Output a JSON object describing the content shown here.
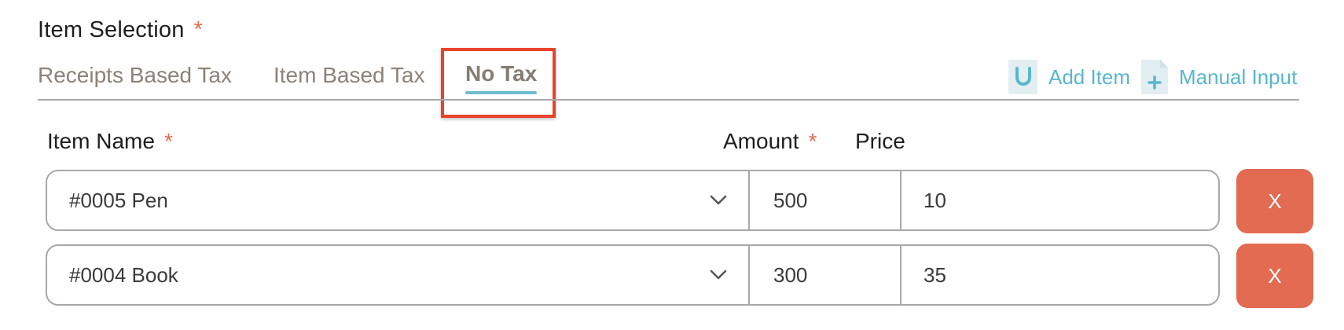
{
  "section": {
    "title": "Item Selection",
    "required_mark": "*"
  },
  "tabs": [
    {
      "label": "Receipts Based Tax",
      "active": false
    },
    {
      "label": "Item Based Tax",
      "active": false
    },
    {
      "label": "No Tax",
      "active": true
    }
  ],
  "actions": {
    "add_item": {
      "label": "Add Item",
      "icon": "add-item-icon"
    },
    "manual_input": {
      "label": "Manual Input",
      "icon": "document-plus-icon"
    }
  },
  "columns": {
    "item_name": "Item Name",
    "amount": "Amount",
    "price": "Price",
    "required_mark": "*"
  },
  "rows": [
    {
      "item": "#0005 Pen",
      "amount": "500",
      "price": "10",
      "remove_label": "X"
    },
    {
      "item": "#0004 Book",
      "amount": "300",
      "price": "35",
      "remove_label": "X"
    }
  ],
  "colors": {
    "accent": "#58b7cc",
    "required": "#e06a4e",
    "remove_button": "#e26b51",
    "highlight": "#e8432a"
  }
}
